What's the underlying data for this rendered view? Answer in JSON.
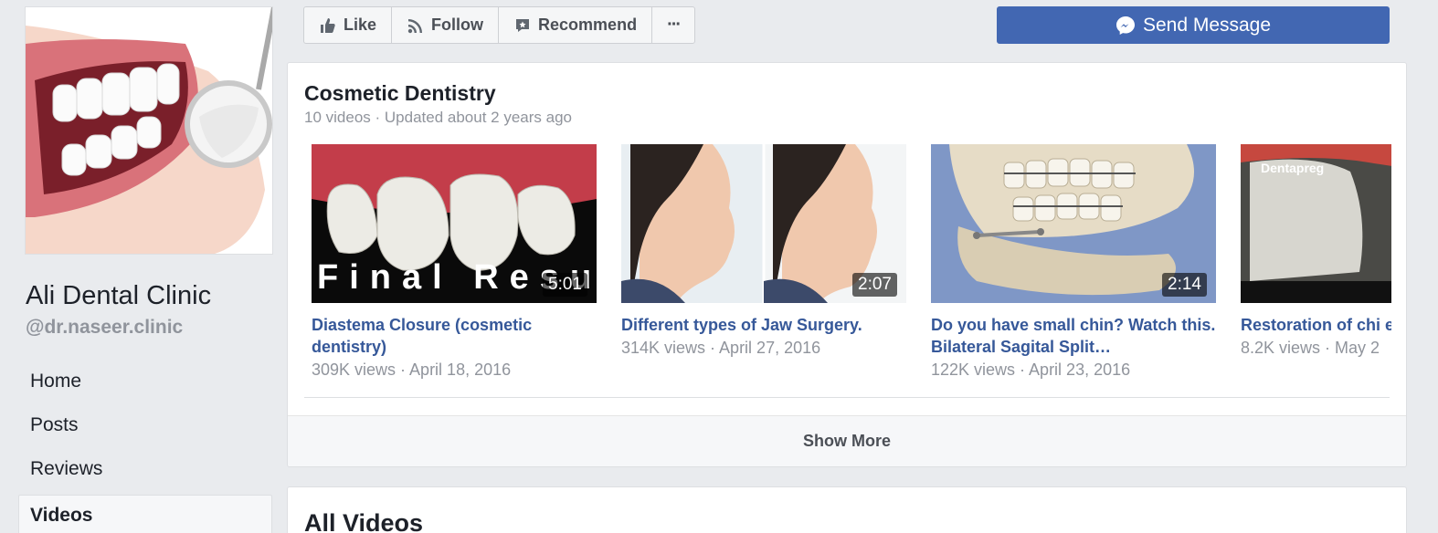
{
  "page": {
    "name": "Ali Dental Clinic",
    "handle": "@dr.naseer.clinic"
  },
  "nav": {
    "items": [
      {
        "label": "Home"
      },
      {
        "label": "Posts"
      },
      {
        "label": "Reviews"
      },
      {
        "label": "Videos",
        "active": true
      }
    ]
  },
  "actions": {
    "like": "Like",
    "follow": "Follow",
    "recommend": "Recommend",
    "more": "···",
    "send_message": "Send Message"
  },
  "playlist": {
    "title": "Cosmetic Dentistry",
    "subtitle": "10 videos · Updated about 2 years ago",
    "videos": [
      {
        "title": "Diastema Closure (cosmetic dentistry)",
        "meta": "309K views · April 18, 2016",
        "duration": "5:01",
        "overlay_text": "Final Result"
      },
      {
        "title": "Different types of Jaw Surgery.",
        "meta": "314K views · April 27, 2016",
        "duration": "2:07"
      },
      {
        "title": "Do you have small chin? Watch this. Bilateral Sagital Split…",
        "meta": "122K views · April 23, 2016",
        "duration": "2:14"
      },
      {
        "title": "Restoration of chi edge.",
        "meta": "8.2K views · May 2",
        "overlay_text": "Dentapreg"
      }
    ],
    "show_more": "Show More"
  },
  "all_videos": {
    "title": "All Videos"
  },
  "colors": {
    "background": "#e9ebee",
    "link": "#365899",
    "primary_button": "#4267b2",
    "muted_text": "#90949c"
  }
}
